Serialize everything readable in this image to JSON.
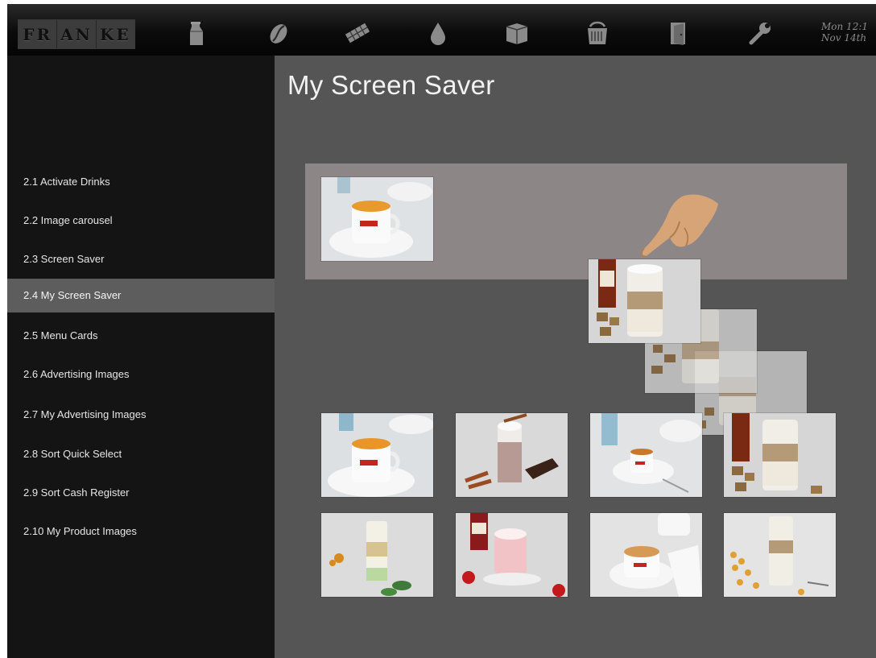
{
  "header": {
    "logo_text": "FRANKE",
    "logo_letters": [
      "FR",
      "AN",
      "KE"
    ],
    "toolbar_icons": [
      "milk-carton-icon",
      "coffee-bean-icon",
      "chocolate-bar-icon",
      "water-drop-icon",
      "package-icon",
      "cleaning-brush-icon",
      "door-icon",
      "wrench-icon"
    ],
    "clock_day": "Mon 12:1",
    "clock_date": "Nov 14th"
  },
  "sidebar": {
    "items": [
      {
        "label": "2.1 Activate Drinks"
      },
      {
        "label": "2.2 Image carousel"
      },
      {
        "label": "2.3 Screen Saver"
      },
      {
        "label": "2.4 My Screen Saver",
        "active": true
      },
      {
        "label": "2.5 Menu Cards"
      },
      {
        "label": "2.6 Advertising Images"
      },
      {
        "label": "2.7 My Advertising Images"
      },
      {
        "label": "2.8 Sort Quick Select"
      },
      {
        "label": "2.9 Sort Cash Register"
      },
      {
        "label": "2.10 My Product Images"
      }
    ]
  },
  "main": {
    "title": "My Screen Saver",
    "selected_images": [
      "espresso-cup-image"
    ],
    "dragging_image": "latte-macchiato-syrup-image",
    "gallery": [
      "espresso-cup-image",
      "hot-chocolate-cinnamon-image",
      "espresso-saucer-image",
      "latte-macchiato-syrup-image",
      "layered-green-drink-image",
      "strawberry-milk-image",
      "cappuccino-cup-image",
      "latte-macchiato-caramel-image"
    ]
  },
  "colors": {
    "topbar": "#0b0b0b",
    "sidebar": "#141414",
    "active_item": "#5d5d5d",
    "content": "#555555",
    "drop_zone": "#8c8686",
    "text": "#e6e6e6"
  }
}
